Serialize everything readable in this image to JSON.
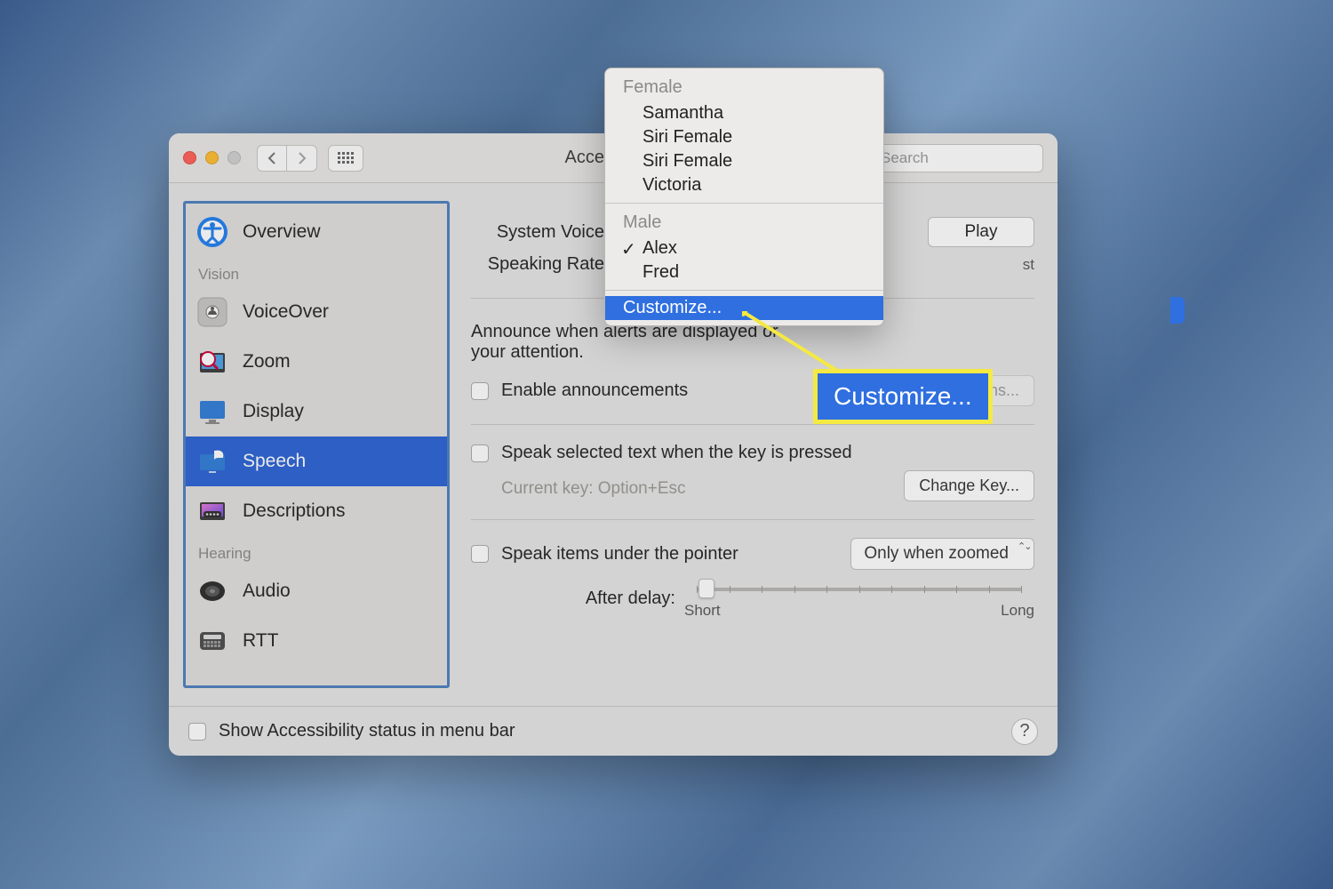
{
  "window": {
    "title": "Accessibility",
    "search_placeholder": "Search"
  },
  "nav": {
    "back_enabled": true,
    "forward_enabled": false
  },
  "sidebar": {
    "items": [
      {
        "label": "Overview",
        "name": "overview"
      },
      {
        "header": "Vision"
      },
      {
        "label": "VoiceOver",
        "name": "voiceover"
      },
      {
        "label": "Zoom",
        "name": "zoom"
      },
      {
        "label": "Display",
        "name": "display"
      },
      {
        "label": "Speech",
        "name": "speech",
        "selected": true
      },
      {
        "label": "Descriptions",
        "name": "descriptions"
      },
      {
        "header": "Hearing"
      },
      {
        "label": "Audio",
        "name": "audio"
      },
      {
        "label": "RTT",
        "name": "rtt"
      }
    ]
  },
  "main": {
    "system_voice_label": "System Voice",
    "play_label": "Play",
    "speaking_rate_label": "Speaking Rate",
    "rate_fast_end": "st",
    "announce_text": "Announce when alerts are displayed or",
    "announce_text2": "your attention.",
    "enable_announcements": "Enable announcements",
    "options_label": "Options...",
    "speak_selected": "Speak selected text when the key is pressed",
    "current_key": "Current key: Option+Esc",
    "change_key": "Change Key...",
    "speak_pointer": "Speak items under the pointer",
    "pointer_mode": "Only when zoomed",
    "after_delay": "After delay:",
    "short": "Short",
    "long": "Long"
  },
  "dropdown": {
    "female_header": "Female",
    "female_voices": [
      "Samantha",
      "Siri Female",
      "Siri Female",
      "Victoria"
    ],
    "male_header": "Male",
    "male_voices": [
      {
        "label": "Alex",
        "checked": true
      },
      {
        "label": "Fred",
        "checked": false
      }
    ],
    "customize": "Customize..."
  },
  "callout": {
    "text": "Customize..."
  },
  "footer": {
    "show_status": "Show Accessibility status in menu bar"
  }
}
